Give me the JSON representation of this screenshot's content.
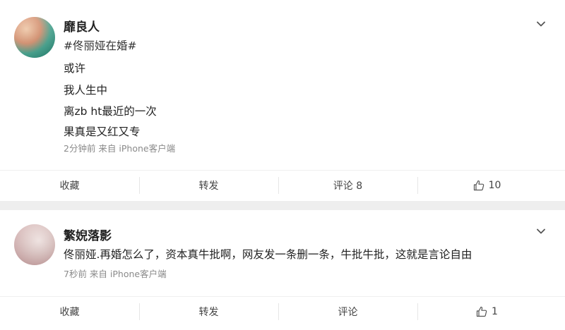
{
  "posts": [
    {
      "username": "靡良人",
      "lines": [
        "#佟丽娅在婚#",
        "或许",
        "我人生中",
        "离zb ht最近的一次",
        "果真是又红又专"
      ],
      "meta": "2分钟前  来自 iPhone客户端",
      "actions": {
        "favorite": "收藏",
        "repost": "转发",
        "comment": "评论 8",
        "like_count": "10"
      }
    },
    {
      "username": "繁婗落影",
      "lines": [
        "佟丽娅.再婚怎么了，资本真牛批啊，网友发一条删一条，牛批牛批，这就是言论自由"
      ],
      "meta": "7秒前  来自 iPhone客户端",
      "actions": {
        "favorite": "收藏",
        "repost": "转发",
        "comment": "评论",
        "like_count": "1"
      }
    }
  ],
  "icons": {
    "expand": "chevron-down-icon",
    "like": "thumbs-up-icon"
  },
  "colors": {
    "background": "#eeeeee",
    "card": "#ffffff",
    "meta_text": "#8a8a8a"
  }
}
